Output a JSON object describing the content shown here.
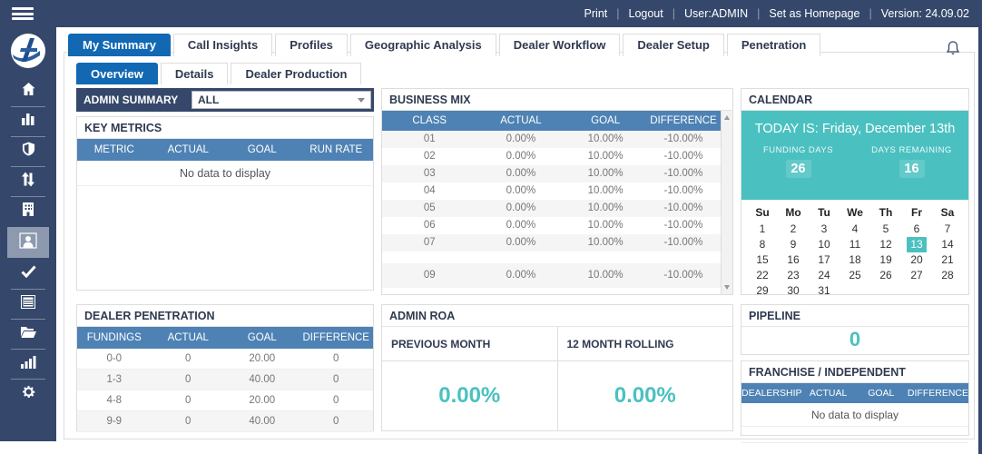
{
  "topbar": {
    "menu_items": [
      "Print",
      "Logout",
      "User:ADMIN",
      "Set as Homepage",
      "Version: 24.09.02"
    ]
  },
  "sidebar": {
    "icons": [
      "home",
      "bar-chart",
      "shield",
      "transfer-arrows",
      "building",
      "user",
      "check",
      "report",
      "folder",
      "signal",
      "settings"
    ],
    "active_icon": "user"
  },
  "main_tabs": [
    {
      "label": "My Summary",
      "active": true
    },
    {
      "label": "Call Insights",
      "active": false
    },
    {
      "label": "Profiles",
      "active": false
    },
    {
      "label": "Geographic Analysis",
      "active": false
    },
    {
      "label": "Dealer Workflow",
      "active": false
    },
    {
      "label": "Dealer Setup",
      "active": false
    },
    {
      "label": "Penetration",
      "active": false
    }
  ],
  "sub_tabs": [
    {
      "label": "Overview",
      "active": true
    },
    {
      "label": "Details",
      "active": false
    },
    {
      "label": "Dealer Production",
      "active": false
    }
  ],
  "admin_summary": {
    "label": "ADMIN SUMMARY",
    "selected": "ALL"
  },
  "key_metrics": {
    "title": "KEY METRICS",
    "columns": [
      "METRIC",
      "ACTUAL",
      "GOAL",
      "RUN RATE"
    ],
    "empty_text": "No data to display"
  },
  "business_mix": {
    "title": "BUSINESS MIX",
    "columns": [
      "CLASS",
      "ACTUAL",
      "GOAL",
      "DIFFERENCE"
    ],
    "rows": [
      [
        "01",
        "0.00%",
        "10.00%",
        "-10.00%"
      ],
      [
        "02",
        "0.00%",
        "10.00%",
        "-10.00%"
      ],
      [
        "03",
        "0.00%",
        "10.00%",
        "-10.00%"
      ],
      [
        "04",
        "0.00%",
        "10.00%",
        "-10.00%"
      ],
      [
        "05",
        "0.00%",
        "10.00%",
        "-10.00%"
      ],
      [
        "06",
        "0.00%",
        "10.00%",
        "-10.00%"
      ],
      [
        "07",
        "0.00%",
        "10.00%",
        "-10.00%"
      ],
      [
        "09",
        "0.00%",
        "10.00%",
        "-10.00%"
      ]
    ]
  },
  "calendar": {
    "title": "CALENDAR",
    "today_banner": "TODAY IS: Friday, December 13th",
    "funding_days_label": "FUNDING DAYS",
    "funding_days": "26",
    "days_remaining_label": "DAYS REMAINING",
    "days_remaining": "16",
    "weekdays": [
      "Su",
      "Mo",
      "Tu",
      "We",
      "Th",
      "Fr",
      "Sa"
    ],
    "days": [
      "1",
      "2",
      "3",
      "4",
      "5",
      "6",
      "7",
      "8",
      "9",
      "10",
      "11",
      "12",
      "13",
      "14",
      "15",
      "16",
      "17",
      "18",
      "19",
      "20",
      "21",
      "22",
      "23",
      "24",
      "25",
      "26",
      "27",
      "28",
      "29",
      "30",
      "31",
      "",
      "",
      "",
      ""
    ],
    "today": "13"
  },
  "dealer_penetration": {
    "title": "DEALER PENETRATION",
    "columns": [
      "FUNDINGS",
      "ACTUAL",
      "GOAL",
      "DIFFERENCE"
    ],
    "rows": [
      [
        "0-0",
        "0",
        "20.00",
        "0"
      ],
      [
        "1-3",
        "0",
        "40.00",
        "0"
      ],
      [
        "4-8",
        "0",
        "20.00",
        "0"
      ],
      [
        "9-9",
        "0",
        "40.00",
        "0"
      ]
    ]
  },
  "admin_roa": {
    "title": "ADMIN ROA",
    "sections": [
      {
        "label": "PREVIOUS MONTH",
        "value": "0.00%"
      },
      {
        "label": "12 MONTH ROLLING",
        "value": "0.00%"
      }
    ]
  },
  "pipeline": {
    "title": "PIPELINE",
    "value": "0"
  },
  "franchise_independent": {
    "title": "FRANCHISE / INDEPENDENT",
    "columns": [
      "DEALERSHIP",
      "ACTUAL",
      "GOAL",
      "DIFFERENCE"
    ],
    "empty_text": "No data to display"
  },
  "colors": {
    "navy": "#35486B",
    "active_tab_blue": "#1268B3",
    "table_header_blue": "#4E82B4",
    "teal_accent": "#4BC0C0",
    "active_sidebar_item": "#8C99AE"
  }
}
